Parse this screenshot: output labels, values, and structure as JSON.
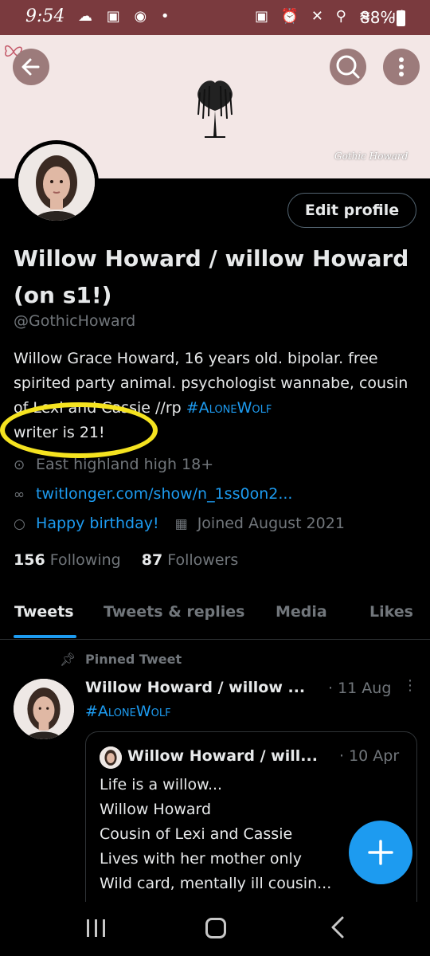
{
  "status_bar": {
    "time": "9:54",
    "left_icons": "☁ ▣ ◉ •",
    "right_icons": "▣ ⏰ ✕ ⚲ ≋ .ıl",
    "battery": "88%"
  },
  "banner": {
    "signature": "Gothic Howard"
  },
  "profile": {
    "edit_button": "Edit profile",
    "display_name": "Willow Howard / willow Howard (on s1!)",
    "handle": "@GothicHoward",
    "bio_text": "Willow Grace Howard, 16 years old. bipolar. free spirited party animal. psychologist wannabe, cousin of Lexi and Cassie //rp ",
    "bio_hashtag": "#AloneWolf",
    "bio_tail": "writer is 21!",
    "location": "East highland high 18+",
    "website": "twitlonger.com/show/n_1ss0on2...",
    "birthday": "Happy birthday!",
    "joined": "Joined August 2021",
    "following_count": "156",
    "following_label": "Following",
    "followers_count": "87",
    "followers_label": "Followers"
  },
  "tabs": [
    {
      "label": "Tweets"
    },
    {
      "label": "Tweets & replies"
    },
    {
      "label": "Media"
    },
    {
      "label": "Likes"
    }
  ],
  "pinned": {
    "label": "Pinned Tweet",
    "author": "Willow Howard / willow ...",
    "date": "· 11 Aug",
    "text": "#AloneWolf",
    "quote": {
      "author": "Willow Howard / will...",
      "date": "· 10 Apr",
      "lines": [
        "Life is a willow...",
        "Willow Howard",
        "Cousin of Lexi and Cassie",
        "Lives with her mother only",
        "Wild card, mentally ill cousin..."
      ]
    }
  },
  "colors": {
    "accent": "#1d9bf0",
    "status_bar": "#7a3a3e",
    "highlight": "#f5e320"
  }
}
